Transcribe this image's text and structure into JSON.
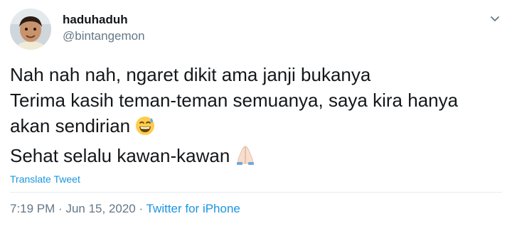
{
  "user": {
    "display_name": "haduhaduh",
    "handle": "@bintangemon"
  },
  "tweet": {
    "lines": [
      "Nah nah nah, ngaret dikit ama janji bukanya",
      "Terima kasih teman-teman semuanya, saya kira hanya",
      "akan sendirian",
      "Sehat selalu kawan-kawan"
    ],
    "emojis": [
      "grinning-sweat-emoji",
      "folded-hands-emoji"
    ],
    "translate_label": "Translate Tweet"
  },
  "meta": {
    "time": "7:19 PM",
    "separator": "·",
    "date": "Jun 15, 2020",
    "source": "Twitter for iPhone"
  },
  "colors": {
    "text": "#14171a",
    "secondary": "#657786",
    "link": "#1b95e0",
    "divider": "#e6ecf0"
  }
}
